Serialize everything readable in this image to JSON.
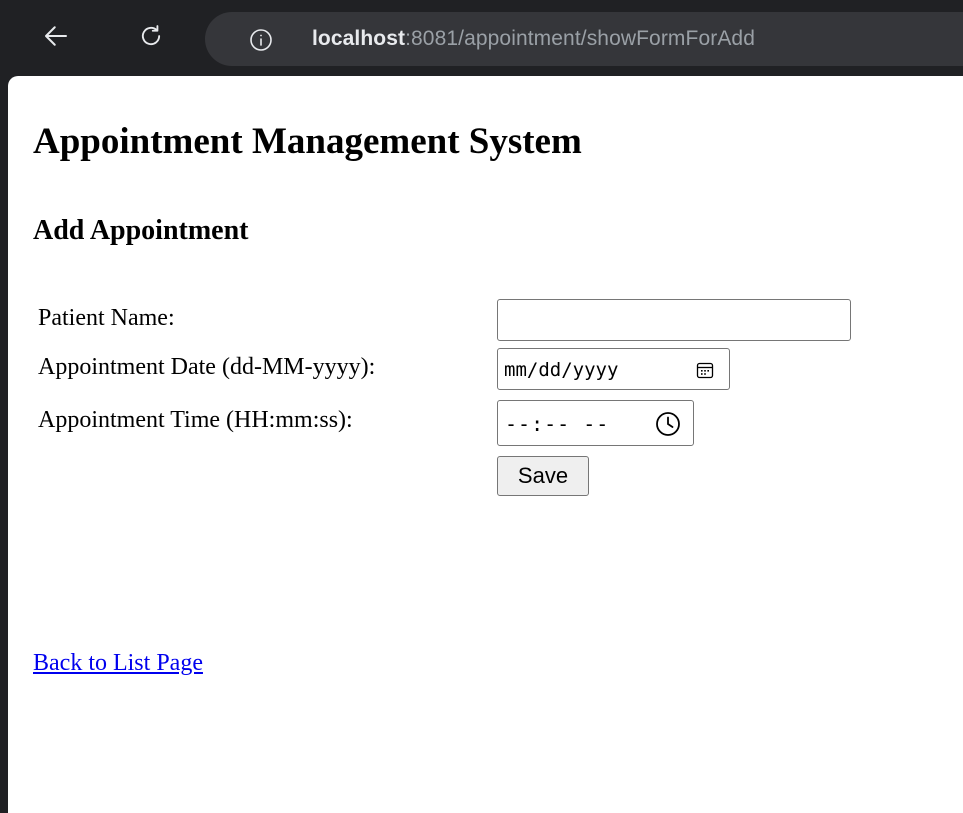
{
  "browser": {
    "url_host": "localhost",
    "url_rest": ":8081/appointment/showFormForAdd",
    "icons": {
      "back": "back-arrow-icon",
      "reload": "reload-icon",
      "site_info": "info-icon"
    }
  },
  "page": {
    "title": "Appointment Management System",
    "subtitle": "Add Appointment"
  },
  "form": {
    "patient_name_label": "Patient Name:",
    "patient_name_value": "",
    "date_label": "Appointment Date (dd-MM-yyyy):",
    "date_value": "mm/dd/yyyy",
    "time_label": "Appointment Time (HH:mm:ss):",
    "time_value": "--:-- --",
    "save_label": "Save"
  },
  "links": {
    "back_to_list": "Back to List Page"
  }
}
